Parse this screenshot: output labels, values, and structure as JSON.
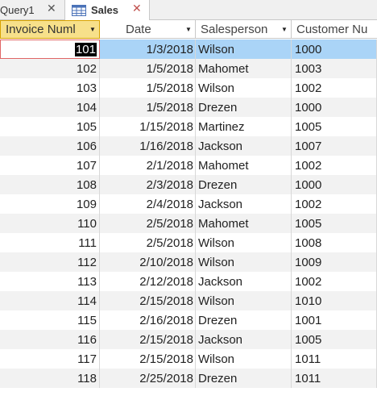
{
  "tabs": [
    {
      "label": "Query1",
      "active": false
    },
    {
      "label": "Sales",
      "active": true
    }
  ],
  "columns": [
    {
      "label": "Invoice Numl",
      "selected": true
    },
    {
      "label": "Date",
      "selected": false
    },
    {
      "label": "Salesperson",
      "selected": false
    },
    {
      "label": "Customer Nu",
      "selected": false
    }
  ],
  "rows": [
    [
      "101",
      "1/3/2018",
      "Wilson",
      "1000"
    ],
    [
      "102",
      "1/5/2018",
      "Mahomet",
      "1003"
    ],
    [
      "103",
      "1/5/2018",
      "Wilson",
      "1002"
    ],
    [
      "104",
      "1/5/2018",
      "Drezen",
      "1000"
    ],
    [
      "105",
      "1/15/2018",
      "Martinez",
      "1005"
    ],
    [
      "106",
      "1/16/2018",
      "Jackson",
      "1007"
    ],
    [
      "107",
      "2/1/2018",
      "Mahomet",
      "1002"
    ],
    [
      "108",
      "2/3/2018",
      "Drezen",
      "1000"
    ],
    [
      "109",
      "2/4/2018",
      "Jackson",
      "1002"
    ],
    [
      "110",
      "2/5/2018",
      "Mahomet",
      "1005"
    ],
    [
      "111",
      "2/5/2018",
      "Wilson",
      "1008"
    ],
    [
      "112",
      "2/10/2018",
      "Wilson",
      "1009"
    ],
    [
      "113",
      "2/12/2018",
      "Jackson",
      "1002"
    ],
    [
      "114",
      "2/15/2018",
      "Wilson",
      "1010"
    ],
    [
      "115",
      "2/16/2018",
      "Drezen",
      "1001"
    ],
    [
      "116",
      "2/15/2018",
      "Jackson",
      "1005"
    ],
    [
      "117",
      "2/15/2018",
      "Wilson",
      "1011"
    ],
    [
      "118",
      "2/25/2018",
      "Drezen",
      "1011"
    ]
  ],
  "selected_row": 0,
  "colors": {
    "header_selected": "#f7e08a",
    "row_selected": "#aad4f7",
    "row_alt": "#f2f2f2"
  }
}
